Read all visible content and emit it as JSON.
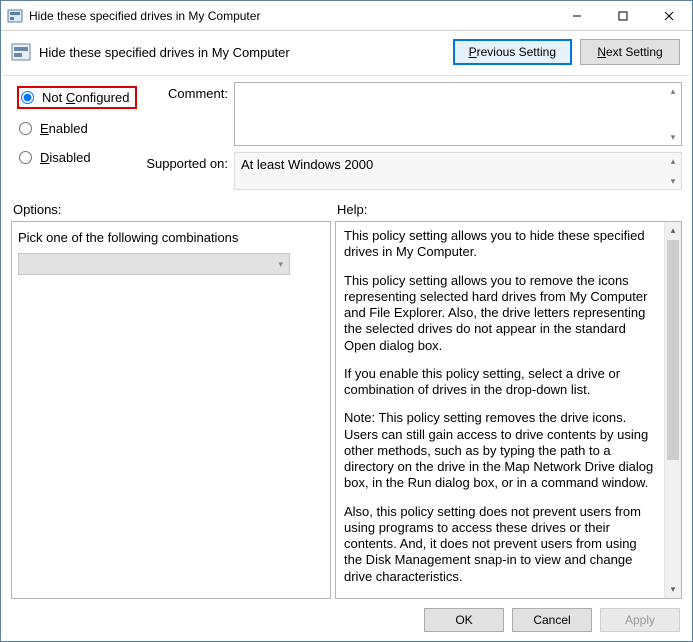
{
  "titlebar": {
    "title": "Hide these specified drives in My Computer"
  },
  "header": {
    "title": "Hide these specified drives in My Computer",
    "prev_label": "Previous Setting",
    "next_label": "Next Setting"
  },
  "radios": {
    "not_configured": "Not Configured",
    "enabled": "Enabled",
    "disabled": "Disabled",
    "selected": "not_configured"
  },
  "fields": {
    "comment_label": "Comment:",
    "comment_value": "",
    "supported_label": "Supported on:",
    "supported_value": "At least Windows 2000"
  },
  "labels": {
    "options": "Options:",
    "help": "Help:"
  },
  "options": {
    "text": "Pick one of the following combinations",
    "combo_value": ""
  },
  "help": {
    "paragraphs": [
      "This policy setting allows you to hide these specified drives in My Computer.",
      "This policy setting allows you to remove the icons representing selected hard drives from My Computer and File Explorer. Also, the drive letters representing the selected drives do not appear in the standard Open dialog box.",
      "If you enable this policy setting, select a drive or combination of drives in the drop-down list.",
      "Note: This policy setting removes the drive icons. Users can still gain access to drive contents by using other methods, such as by typing the path to a directory on the drive in the Map Network Drive dialog box, in the Run dialog box, or in a command window.",
      "Also, this policy setting does not prevent users from using programs to access these drives or their contents. And, it does not prevent users from using the Disk Management snap-in to view and change drive characteristics."
    ]
  },
  "footer": {
    "ok": "OK",
    "cancel": "Cancel",
    "apply": "Apply"
  }
}
